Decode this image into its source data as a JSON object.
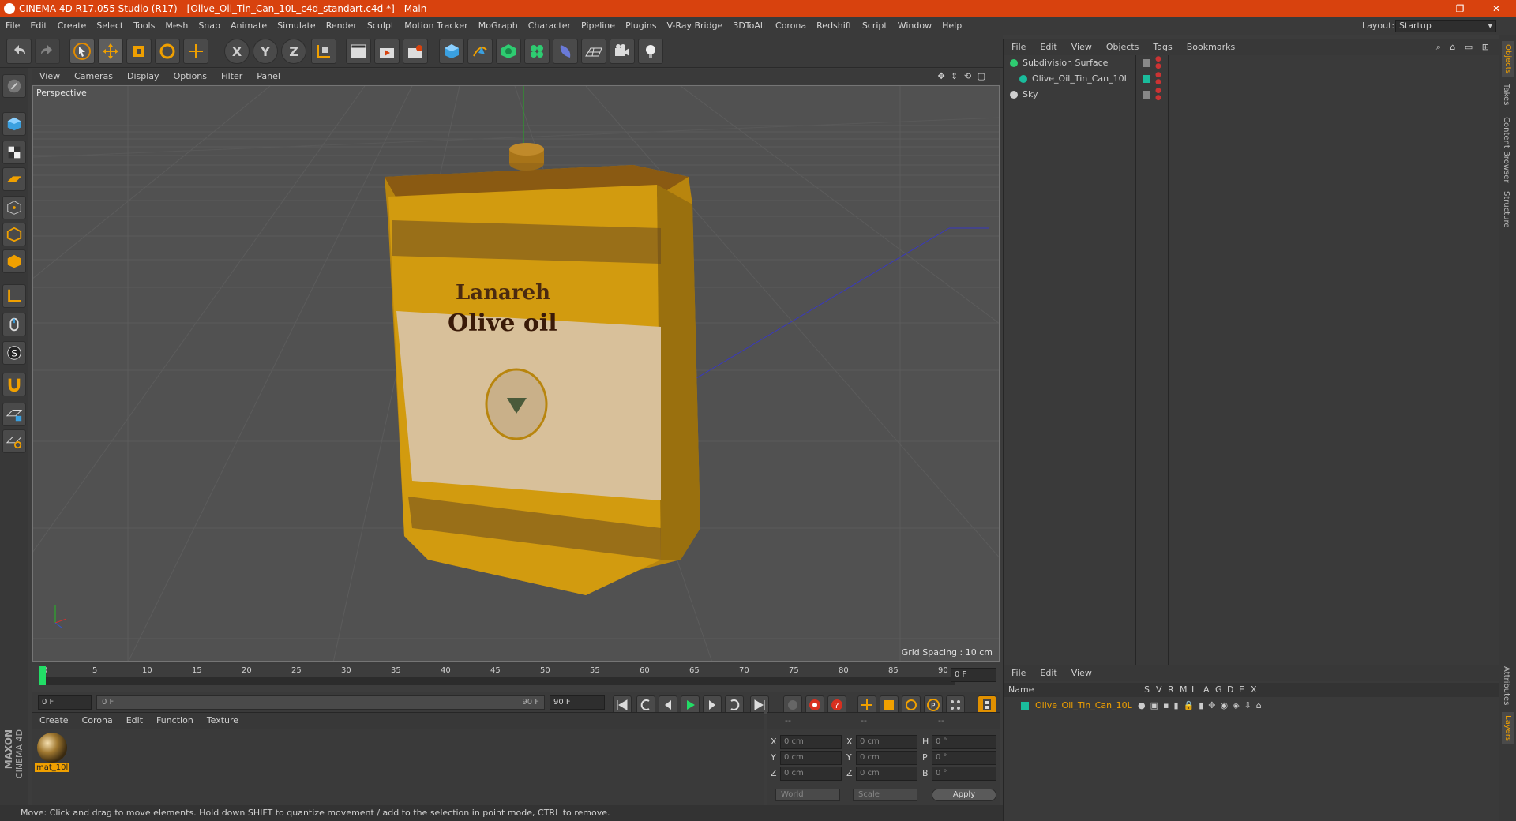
{
  "window": {
    "title": "CINEMA 4D R17.055 Studio (R17) - [Olive_Oil_Tin_Can_10L_c4d_standart.c4d *] - Main",
    "minimize": "—",
    "restore": "❐",
    "close": "✕"
  },
  "menubar": [
    "File",
    "Edit",
    "Create",
    "Select",
    "Tools",
    "Mesh",
    "Snap",
    "Animate",
    "Simulate",
    "Render",
    "Sculpt",
    "Motion Tracker",
    "MoGraph",
    "Character",
    "Pipeline",
    "Plugins",
    "V-Ray Bridge",
    "3DToAll",
    "Corona",
    "Redshift",
    "Script",
    "Window",
    "Help"
  ],
  "layout": {
    "label": "Layout:",
    "value": "Startup"
  },
  "toolbar": {
    "x": "X",
    "y": "Y",
    "z": "Z"
  },
  "viewport": {
    "menu": [
      "View",
      "Cameras",
      "Display",
      "Options",
      "Filter",
      "Panel"
    ],
    "camera": "Perspective",
    "grid_spacing": "Grid Spacing : 10 cm"
  },
  "timeline": {
    "ticks": [
      "0",
      "5",
      "10",
      "15",
      "20",
      "25",
      "30",
      "35",
      "40",
      "45",
      "50",
      "55",
      "60",
      "65",
      "70",
      "75",
      "80",
      "85",
      "90"
    ],
    "current_frame": "0 F",
    "start": "0 F",
    "range_start": "0 F",
    "range_end": "90 F",
    "end": "90 F"
  },
  "material_panel": {
    "menu": [
      "Create",
      "Corona",
      "Edit",
      "Function",
      "Texture"
    ],
    "materials": [
      {
        "name": "mat_10l"
      }
    ]
  },
  "coord_panel": {
    "headers": [
      "--",
      "--",
      "--"
    ],
    "rows": [
      {
        "axis": "X",
        "pos": "0 cm",
        "axis2": "X",
        "size": "0 cm",
        "rot_label": "H",
        "rot": "0 °"
      },
      {
        "axis": "Y",
        "pos": "0 cm",
        "axis2": "Y",
        "size": "0 cm",
        "rot_label": "P",
        "rot": "0 °"
      },
      {
        "axis": "Z",
        "pos": "0 cm",
        "axis2": "Z",
        "size": "0 cm",
        "rot_label": "B",
        "rot": "0 °"
      }
    ],
    "mode1": "World",
    "mode2": "Scale",
    "apply": "Apply"
  },
  "object_manager": {
    "menu": [
      "File",
      "Edit",
      "View",
      "Objects",
      "Tags",
      "Bookmarks"
    ],
    "objects": [
      {
        "name": "Subdivision Surface",
        "color": "#2ecc71"
      },
      {
        "name": "Olive_Oil_Tin_Can_10L",
        "color": "#1abc9c"
      },
      {
        "name": "Sky",
        "color": "#cfcfcf"
      }
    ]
  },
  "layer_manager": {
    "menu": [
      "File",
      "Edit",
      "View"
    ],
    "columns": [
      "Name",
      "S",
      "V",
      "R",
      "M",
      "L",
      "A",
      "G",
      "D",
      "E",
      "X"
    ],
    "layers": [
      {
        "name": "Olive_Oil_Tin_Can_10L",
        "color": "#1abc9c"
      }
    ]
  },
  "right_tabs": [
    "Objects",
    "Takes",
    "Content Browser",
    "Structure"
  ],
  "right_tabs_bottom": [
    "Attributes",
    "Layers"
  ],
  "brand": {
    "line1": "MAXON",
    "line2": "CINEMA 4D"
  },
  "status": "Move: Click and drag to move elements. Hold down SHIFT to quantize movement / add to the selection in point mode, CTRL to remove.",
  "can_label": {
    "line1": "Lanareh",
    "line2": "Olive oil"
  },
  "colors": {
    "accent": "#d8420e",
    "orange_text": "#f0a000",
    "green_axis": "#22aa22"
  }
}
